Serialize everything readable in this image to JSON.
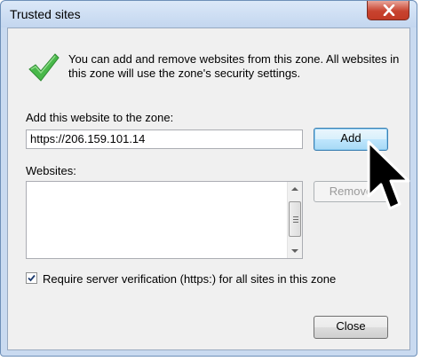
{
  "window": {
    "title": "Trusted sites"
  },
  "info": {
    "line1": "You can add and remove websites from this zone. All websites in",
    "line2": "this zone will use the zone's security settings."
  },
  "add_site": {
    "label": "Add this website to the zone:",
    "value": "https://206.159.101.14",
    "button": "Add"
  },
  "websites": {
    "label": "Websites:",
    "items": [],
    "remove_button": "Remove"
  },
  "verification": {
    "checked": true,
    "label": "Require server verification (https:) for all sites in this zone"
  },
  "footer": {
    "close_button": "Close"
  },
  "icons": {
    "checkmark": "green-checkmark-icon",
    "cursor": "mouse-pointer-icon"
  },
  "colors": {
    "check_green": "#3caa3c",
    "close_red": "#c8432f",
    "add_focus_blue": "#3c7fb1"
  }
}
